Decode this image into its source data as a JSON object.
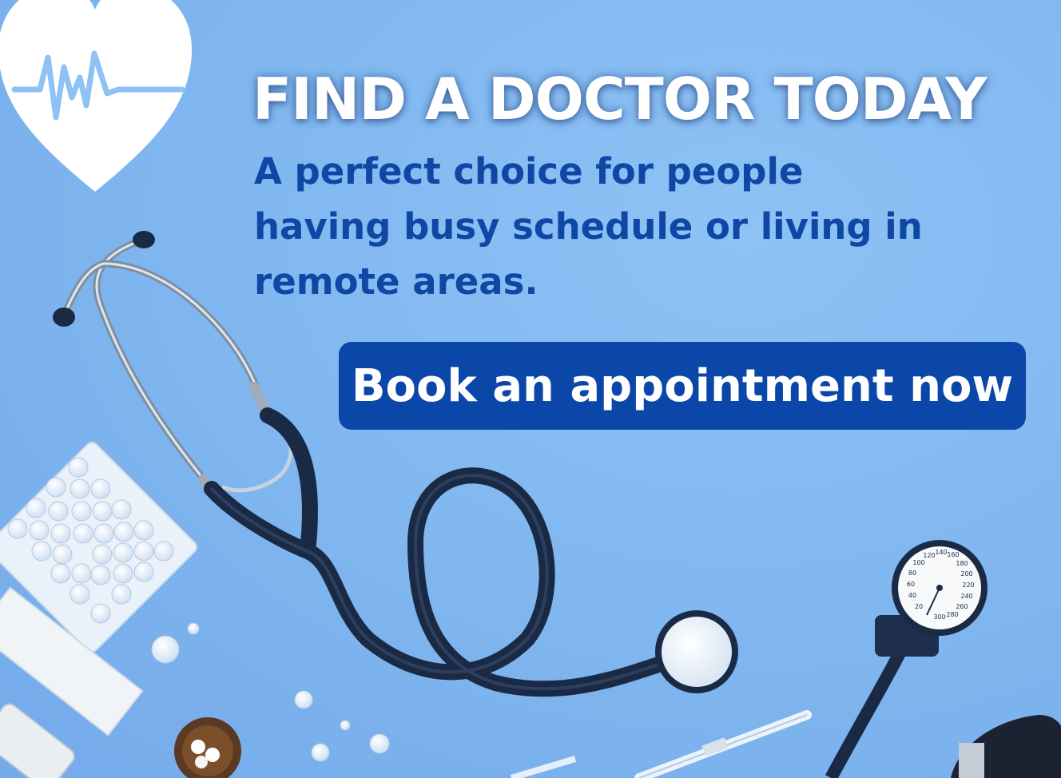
{
  "hero": {
    "title": "FIND A DOCTOR TODAY",
    "subtitle_lines": [
      "A perfect choice for people",
      "having busy schedule or living in",
      "remote areas."
    ]
  },
  "cta": {
    "label": "Book an appointment now"
  },
  "icons": [
    "heart-pulse-icon",
    "stethoscope-icon",
    "pill-blister-icon",
    "blood-pressure-gauge-icon",
    "syringe-icon",
    "pill-bottle-icon",
    "thermometer-icon",
    "bandage-icon"
  ],
  "gauge": {
    "ticks": [
      "20",
      "40",
      "60",
      "80",
      "100",
      "120",
      "140",
      "160",
      "180",
      "200",
      "220",
      "240",
      "260",
      "280",
      "300"
    ]
  },
  "colors": {
    "background": "#7fb6ef",
    "title": "#ffffff",
    "subtitle": "#0f47a5",
    "button": "#0a47a8",
    "button_text": "#ffffff"
  }
}
